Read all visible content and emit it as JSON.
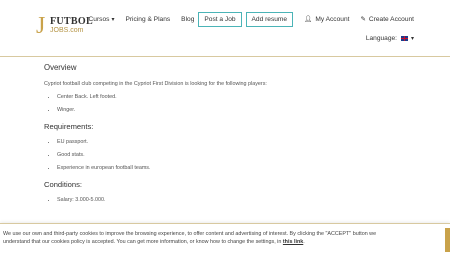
{
  "header": {
    "logo_glyph": "J",
    "logo_line1": "FUTBOL",
    "logo_line2": "JOBS.com",
    "nav": {
      "cursos": "Cursos",
      "pricing": "Pricing & Plans",
      "blog": "Blog",
      "post_job": "Post a Job",
      "add_resume": "Add resume",
      "my_account": "My Account",
      "create_account": "Create Account"
    },
    "language_label": "Language:",
    "chevron": "▾"
  },
  "main": {
    "overview_title": "Overview",
    "intro": "Cypriot football club competing in the Cypriot First Division is looking for the following players:",
    "players": [
      "Center Back. Left footed.",
      "Winger."
    ],
    "requirements_title": "Requirements:",
    "requirements": [
      "EU passport.",
      "Good stats.",
      "Experience in european football teams."
    ],
    "conditions_title": "Conditions:",
    "conditions": [
      "Salary: 3.000-5.000."
    ]
  },
  "cookie": {
    "text": "We use our own and third-party cookies to improve the browsing experience, to offer content and advertising of interest. By clicking the \"ACCEPT\" button we understand that our cookies policy is accepted. You can get more information, or know how to change the settings, in",
    "link": "this link",
    "end": "."
  },
  "colors": {
    "accent": "#4bb4b7",
    "brand": "#c9a24a"
  }
}
